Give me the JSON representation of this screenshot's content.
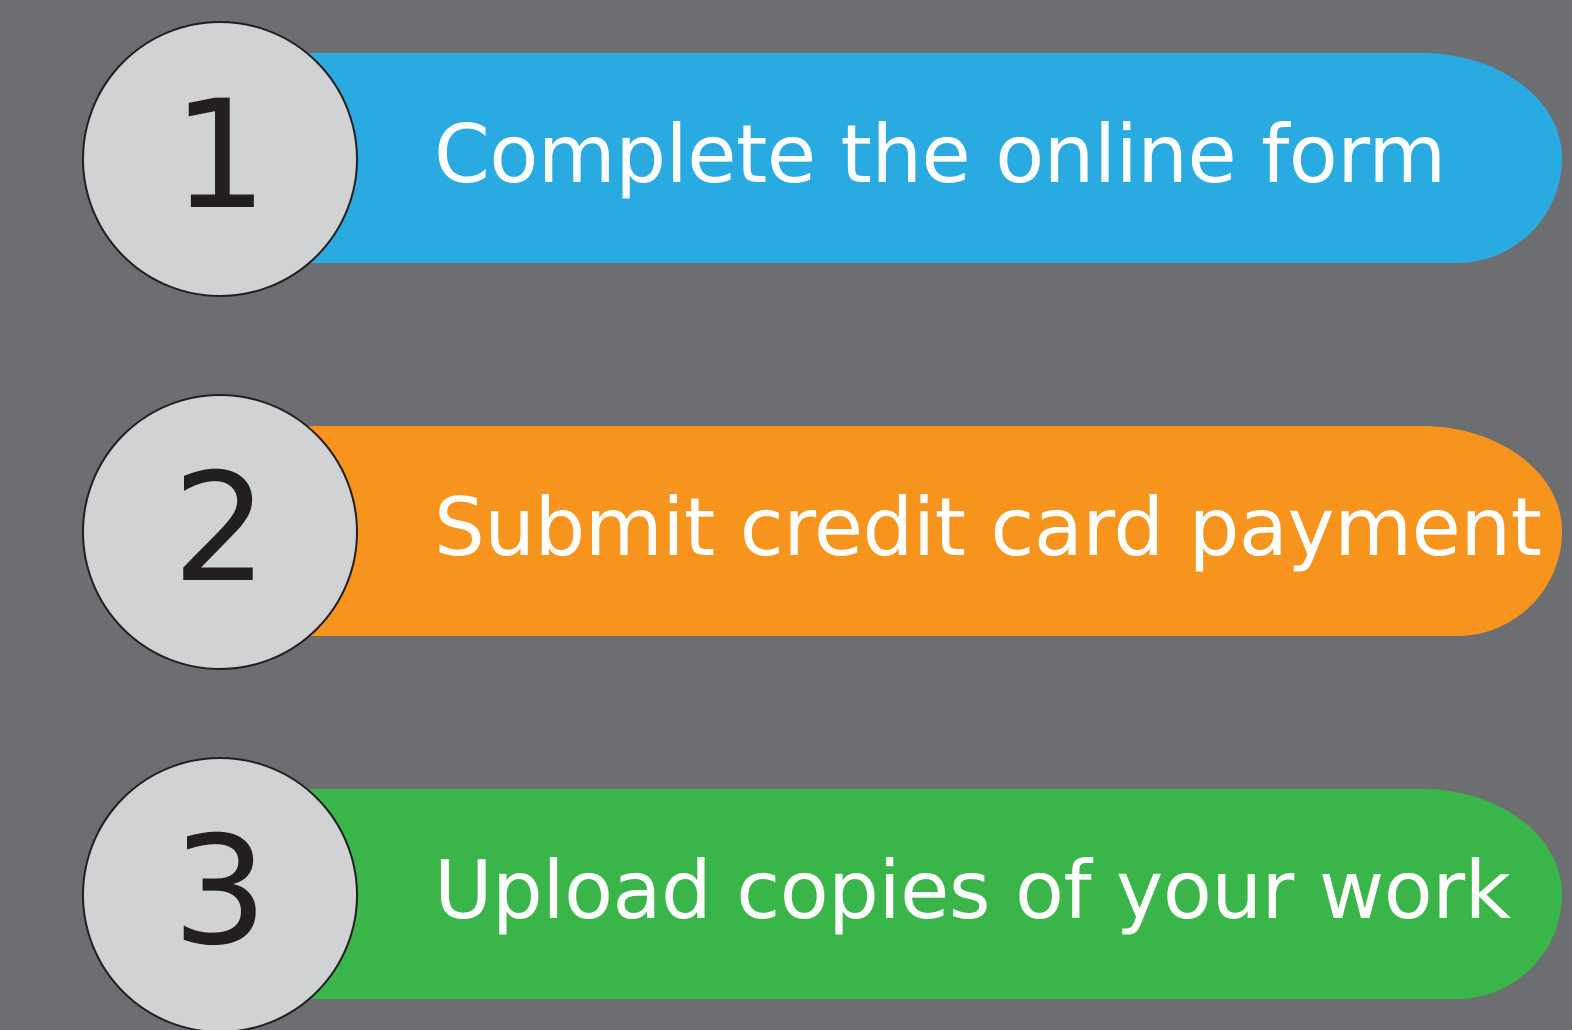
{
  "steps": [
    {
      "number": "1",
      "label": "Complete the online form",
      "color": "#29abe2"
    },
    {
      "number": "2",
      "label": "Submit credit card payment",
      "color": "#f7941d"
    },
    {
      "number": "3",
      "label": "Upload copies of your work",
      "color": "#39b54a"
    }
  ],
  "colors": {
    "background": "#6d6e71",
    "circle_fill": "#d1d2d4",
    "circle_outline": "#231f20",
    "label_text": "#ffffff"
  }
}
